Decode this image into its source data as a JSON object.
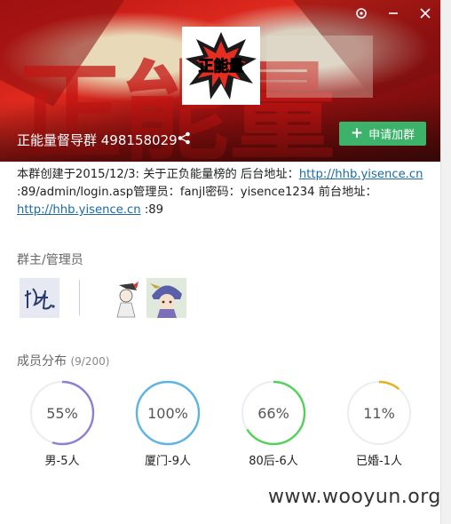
{
  "window": {
    "pin_icon": "pin-icon",
    "close_icon": "close-icon"
  },
  "header": {
    "logo_text": "正能量",
    "group_name": "正能量督导群 498158029",
    "join_button": "申请加群"
  },
  "description": {
    "part1": "本群创建于2015/12/3:  关于正负能量榜的 后台地址：",
    "link1": "http://hhb.yisence.cn",
    "part2": ":89/admin/login.asp管理员：fanjl密码：yisence1234     前台地址：",
    "link2": "http://hhb.yisence.cn",
    "part3": " :89"
  },
  "admins": {
    "label": "群主/管理员"
  },
  "members": {
    "label": "成员分布",
    "count": "(9/200)",
    "stats": [
      {
        "pct": "55%",
        "value": 0.55,
        "label": "男-5人",
        "color": "#8e7fd6"
      },
      {
        "pct": "100%",
        "value": 1.0,
        "label": "厦门-9人",
        "color": "#5db4e3"
      },
      {
        "pct": "66%",
        "value": 0.66,
        "label": "80后-6人",
        "color": "#53d15a"
      },
      {
        "pct": "11%",
        "value": 0.11,
        "label": "已婚-1人",
        "color": "#e2b21a"
      }
    ]
  },
  "watermark": "www.wooyun.org"
}
